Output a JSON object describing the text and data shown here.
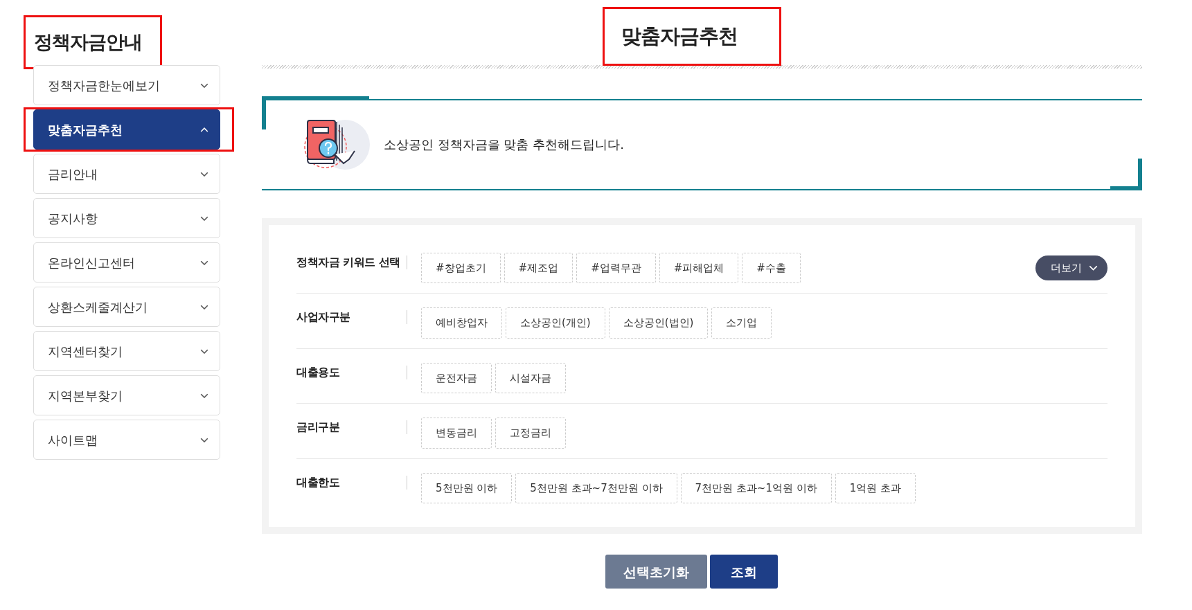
{
  "sidebar": {
    "title": "정책자금안내",
    "title_annotated": true,
    "items": [
      {
        "label": "정책자금한눈에보기",
        "selected": false,
        "expanded": false,
        "annotated": false
      },
      {
        "label": "맞춤자금추천",
        "selected": true,
        "expanded": true,
        "annotated": true
      },
      {
        "label": "금리안내",
        "selected": false,
        "expanded": false,
        "annotated": false
      },
      {
        "label": "공지사항",
        "selected": false,
        "expanded": false,
        "annotated": false
      },
      {
        "label": "온라인신고센터",
        "selected": false,
        "expanded": false,
        "annotated": false
      },
      {
        "label": "상환스케줄계산기",
        "selected": false,
        "expanded": false,
        "annotated": false
      },
      {
        "label": "지역센터찾기",
        "selected": false,
        "expanded": false,
        "annotated": false
      },
      {
        "label": "지역본부찾기",
        "selected": false,
        "expanded": false,
        "annotated": false
      },
      {
        "label": "사이트맵",
        "selected": false,
        "expanded": false,
        "annotated": false
      }
    ]
  },
  "page_title": "맞춤자금추천",
  "page_title_annotated": true,
  "banner": {
    "text": "소상공인 정책자금을 맞춤 추천해드립니다."
  },
  "filters": [
    {
      "label": "정책자금 키워드 선택",
      "more_button": "더보기",
      "options": [
        {
          "label": "#창업초기",
          "selected": false
        },
        {
          "label": "#제조업",
          "selected": false
        },
        {
          "label": "#업력무관",
          "selected": false
        },
        {
          "label": "#피해업체",
          "selected": false
        },
        {
          "label": "#수출",
          "selected": false
        }
      ]
    },
    {
      "label": "사업자구분",
      "options": [
        {
          "label": "예비창업자",
          "selected": false
        },
        {
          "label": "소상공인(개인)",
          "selected": false
        },
        {
          "label": "소상공인(법인)",
          "selected": false
        },
        {
          "label": "소기업",
          "selected": false
        }
      ]
    },
    {
      "label": "대출용도",
      "options": [
        {
          "label": "운전자금",
          "selected": false
        },
        {
          "label": "시설자금",
          "selected": false
        }
      ]
    },
    {
      "label": "금리구분",
      "options": [
        {
          "label": "변동금리",
          "selected": false
        },
        {
          "label": "고정금리",
          "selected": false
        }
      ]
    },
    {
      "label": "대출한도",
      "options": [
        {
          "label": "5천만원 이하",
          "selected": false
        },
        {
          "label": "5천만원 초과~7천만원 이하",
          "selected": false
        },
        {
          "label": "7천만원 초과~1억원 이하",
          "selected": false
        },
        {
          "label": "1억원 초과",
          "selected": false
        }
      ]
    }
  ],
  "buttons": {
    "reset": "선택초기화",
    "search": "조회"
  }
}
